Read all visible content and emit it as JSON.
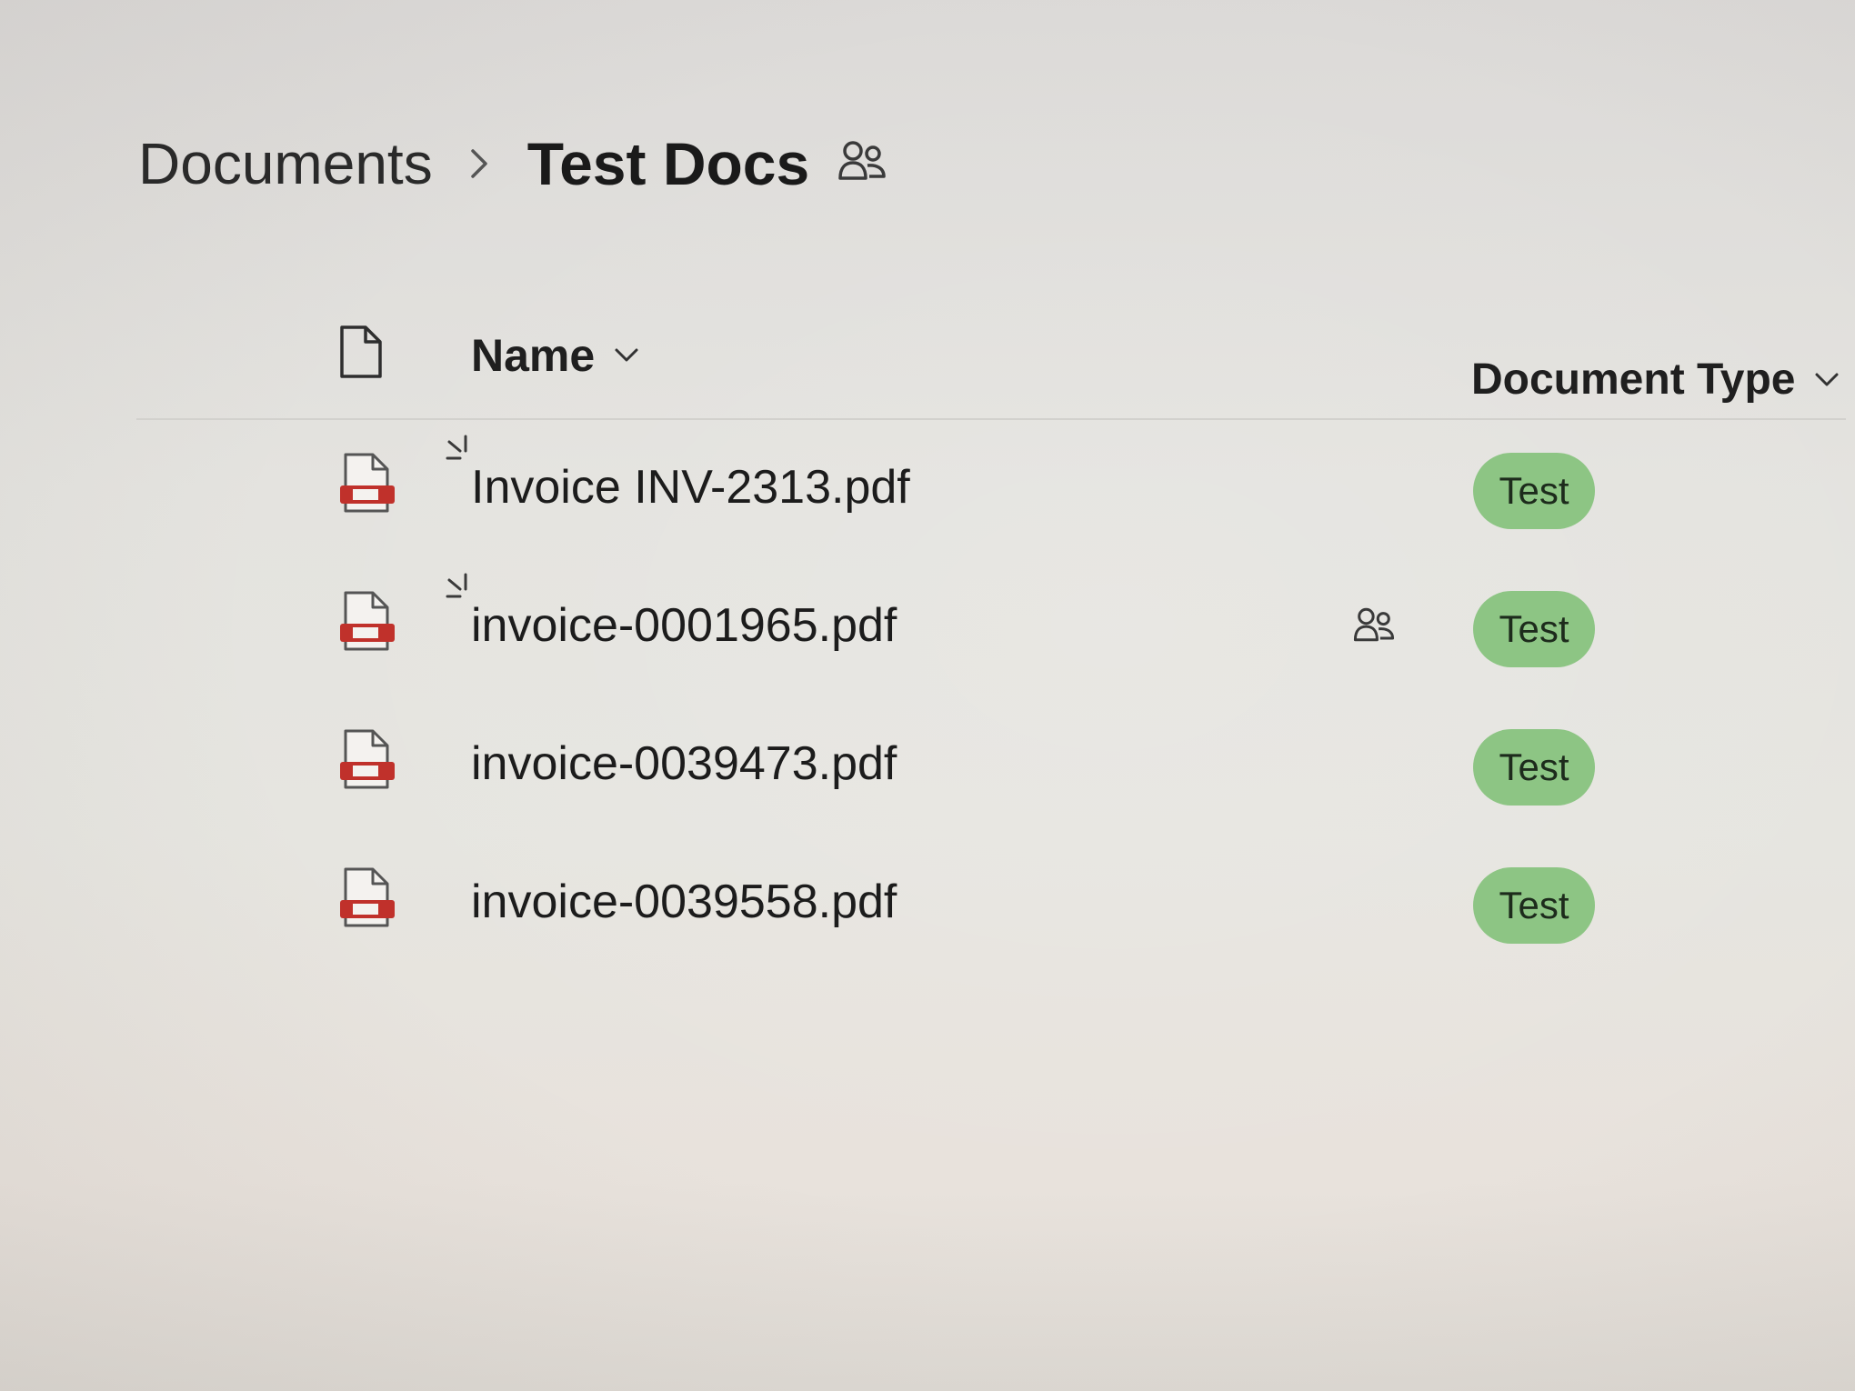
{
  "breadcrumb": {
    "root": "Documents",
    "current": "Test Docs",
    "separator_icon": "chevron-right-icon",
    "shared_icon": "people-icon"
  },
  "columns": {
    "file_type_icon": "document-icon",
    "name": "Name",
    "document_type": "Document Type",
    "sort_icon": "chevron-down-icon"
  },
  "files": [
    {
      "name": "Invoice INV-2313.pdf",
      "icon": "pdf-icon",
      "new": true,
      "shared": false,
      "document_type": "Test"
    },
    {
      "name": "invoice-0001965.pdf",
      "icon": "pdf-icon",
      "new": true,
      "shared": true,
      "document_type": "Test"
    },
    {
      "name": "invoice-0039473.pdf",
      "icon": "pdf-icon",
      "new": false,
      "shared": false,
      "document_type": "Test"
    },
    {
      "name": "invoice-0039558.pdf",
      "icon": "pdf-icon",
      "new": false,
      "shared": false,
      "document_type": "Test"
    }
  ],
  "colors": {
    "tag_background": "#8dc584",
    "tag_text": "#1d2b1c",
    "pdf_red": "#c0312b",
    "new_mark": "#3a3a3a"
  }
}
